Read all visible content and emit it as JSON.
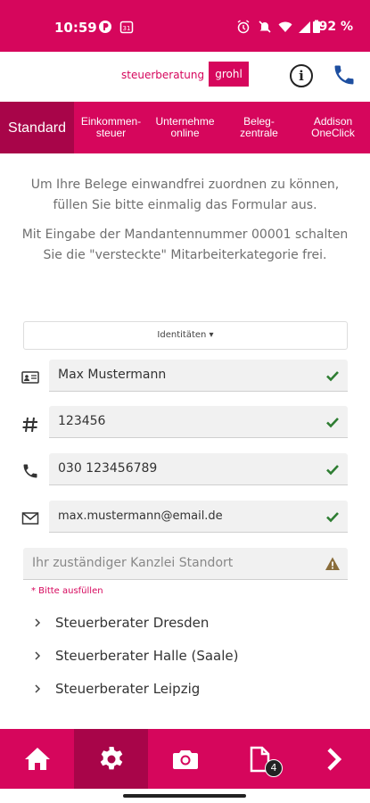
{
  "statusbar": {
    "time": "10:59",
    "battery": "92 %"
  },
  "header": {
    "logo_text": "steuerberatung",
    "logo_box": "grohl",
    "info_icon": "info-icon",
    "phone_icon": "phone-icon"
  },
  "tabs": [
    {
      "label": "Standard",
      "active": true
    },
    {
      "label": "Einkommen-\nsteuer",
      "active": false
    },
    {
      "label": "Unternehme\nonline",
      "active": false
    },
    {
      "label": "Beleg-\nzentrale",
      "active": false
    },
    {
      "label": "Addison\nOneClick",
      "active": false
    }
  ],
  "intro": {
    "p1": "Um Ihre Belege einwandfrei zuordnen zu können, füllen Sie bitte einmalig das Formular aus.",
    "p2": "Mit Eingabe der Mandantennummer 00001 schalten Sie die \"versteckte\" Mitarbeiterkategorie frei."
  },
  "dropdown": {
    "label": "Identitäten ▾"
  },
  "fields": {
    "name": {
      "value": "Max Mustermann"
    },
    "number": {
      "value": "123456"
    },
    "phone": {
      "value": "030 123456789"
    },
    "email": {
      "value": "max.mustermann@email.de"
    },
    "location": {
      "placeholder": "Ihr zuständiger Kanzlei Standort"
    }
  },
  "hint": "* Bitte ausfüllen",
  "locations": [
    "Steuerberater Dresden",
    "Steuerberater Halle (Saale)",
    "Steuerberater Leipzig"
  ],
  "bottomnav": {
    "documents_badge": "4"
  },
  "colors": {
    "brand": "#d6065c",
    "brand_dark": "#a80549",
    "check": "#2e7d32",
    "warning": "#8a6d3b"
  }
}
